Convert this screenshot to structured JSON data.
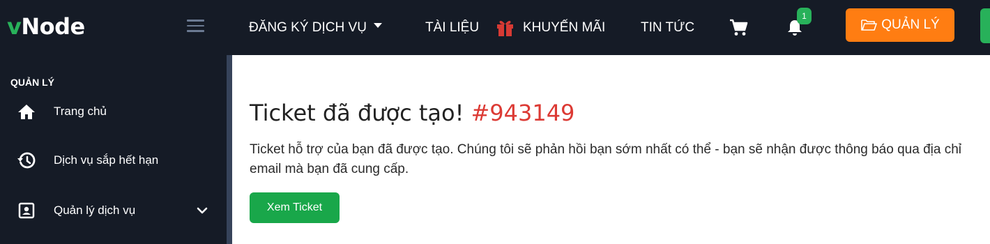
{
  "brand": {
    "prefix": "v",
    "rest": "Node"
  },
  "sidebar": {
    "section_title": "QUẢN LÝ",
    "items": [
      {
        "label": "Trang chủ",
        "icon": "home-icon"
      },
      {
        "label": "Dịch vụ sắp hết hạn",
        "icon": "history-icon"
      },
      {
        "label": "Quản lý dịch vụ",
        "icon": "contact-card-icon",
        "chevron": "chevron-down-icon"
      }
    ]
  },
  "navbar": {
    "register_service": "ĐĂNG KÝ DỊCH VỤ",
    "docs": "TÀI LIỆU",
    "promo": "KHUYẾN MÃI",
    "news": "TIN TỨC",
    "notification_count": "1",
    "manage_button": "QUẢN LÝ"
  },
  "main": {
    "title": "Ticket đã được tạo!",
    "ticket_number": "#943149",
    "message": "Ticket hỗ trợ của bạn đã được tạo. Chúng tôi sẽ phản hồi bạn sớm nhất có thể - bạn sẽ nhận được thông báo qua địa chỉ email mà bạn đã cung cấp.",
    "view_button": "Xem Ticket"
  },
  "colors": {
    "dark": "#151b26",
    "green": "#28b15a",
    "orange": "#ff7d12",
    "red": "#dc3a34"
  }
}
